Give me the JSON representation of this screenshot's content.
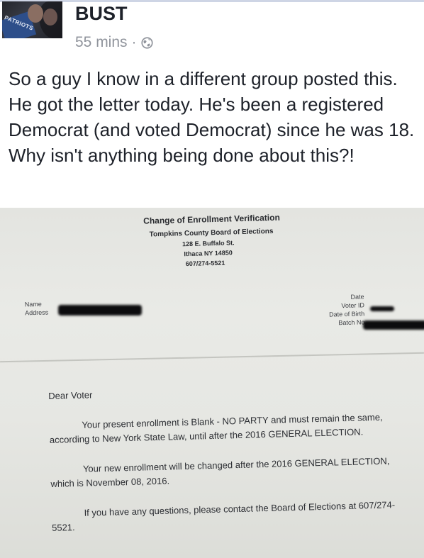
{
  "post": {
    "author": "BUST",
    "time": "55 mins",
    "separator": "·",
    "privacy_icon": "globe-icon",
    "avatar_logo": "PATRIOTS",
    "text": "So a guy I know in a different group posted this. He got the letter today. He's been a registered Democrat (and voted Democrat) since he was 18. Why isn't anything being done about this?!"
  },
  "letter": {
    "title": "Change of Enrollment Verification",
    "org": "Tompkins County Board of Elections",
    "street": "128 E. Buffalo St.",
    "city": "Ithaca NY  14850",
    "phone": "607/274-5521",
    "field_name": "Name",
    "field_address": "Address",
    "field_date": "Date",
    "field_voter_id": "Voter ID",
    "field_dob": "Date of Birth",
    "field_batch": "Batch No",
    "salutation": "Dear Voter",
    "paragraph1": "Your present enrollment is Blank - NO PARTY and must remain the same, according to New York State Law, until after the 2016 GENERAL ELECTION.",
    "paragraph2": "Your new enrollment will be changed after the 2016 GENERAL ELECTION, which is November 08, 2016.",
    "paragraph3": "If you have any questions, please contact the Board of Elections at 607/274-5521."
  },
  "colors": {
    "author": "#1d2129",
    "meta": "#90949c",
    "paper": "#e6e7e3"
  }
}
